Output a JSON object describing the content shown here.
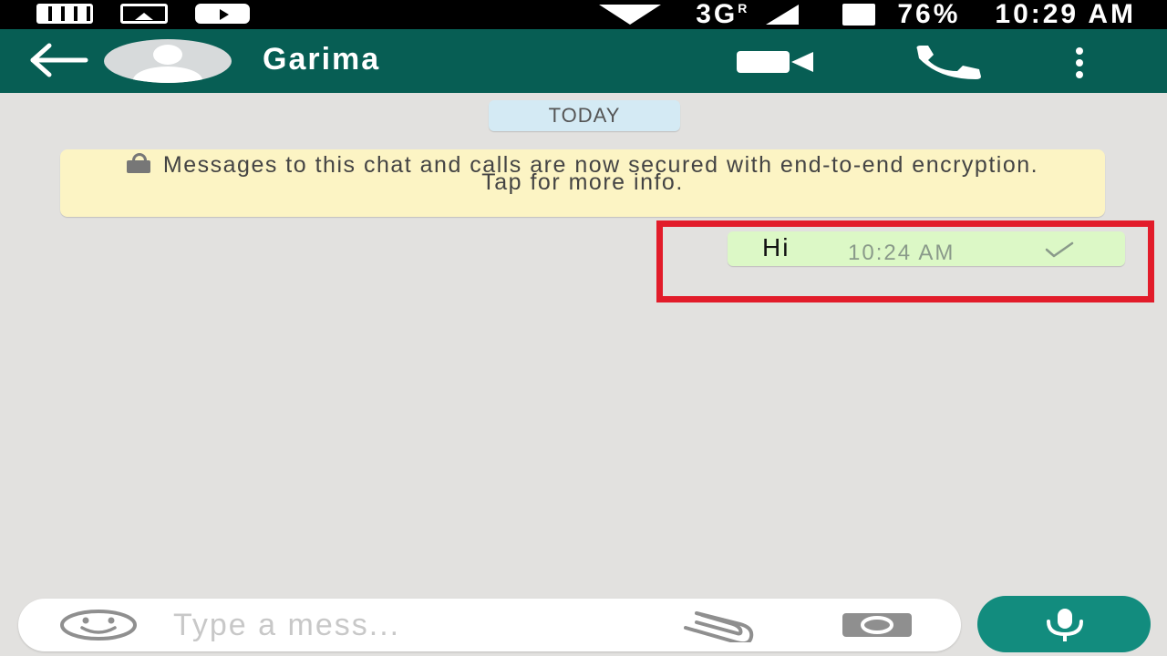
{
  "status_bar": {
    "network": "3G",
    "network_sup": "R",
    "battery": "76%",
    "time": "10:29 AM",
    "icons": [
      "notification-icon",
      "image-icon",
      "youtube-icon",
      "wifi-icon",
      "signal-icon",
      "battery-icon"
    ]
  },
  "header": {
    "contact_name": "Garima",
    "icons": [
      "back-arrow-icon",
      "avatar",
      "video-call-icon",
      "phone-icon",
      "more-vert-icon"
    ]
  },
  "chat": {
    "date_label": "TODAY",
    "encryption_notice": "Messages to this chat and calls are now secured with end-to-end encryption. Tap for more info.",
    "messages": [
      {
        "text": "Hi",
        "time": "10:24 AM",
        "status": "sent-single-tick",
        "outgoing": true
      }
    ]
  },
  "composer": {
    "placeholder": "Type a mess...",
    "icons": [
      "emoji-icon",
      "attach-icon",
      "camera-icon",
      "mic-icon"
    ]
  },
  "colors": {
    "header": "#075e54",
    "chat_background": "#e2e1df",
    "outgoing_bubble": "#dcf8c6",
    "notice_background": "#fcf4c4",
    "date_chip": "#d4eaf4",
    "mic_button": "#128c7e",
    "highlight": "#e21c2a"
  }
}
